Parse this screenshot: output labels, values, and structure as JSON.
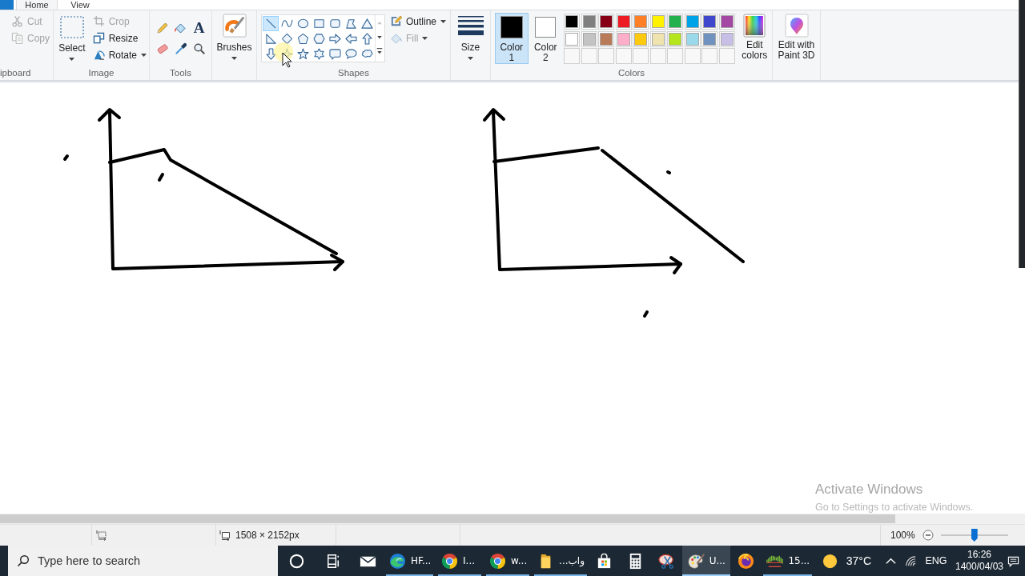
{
  "tabs": [
    {
      "label": "Home",
      "selected": true
    },
    {
      "label": "View",
      "selected": false
    }
  ],
  "ribbon": {
    "clipboard": {
      "label": "ipboard",
      "commands": [
        {
          "kind": "cut",
          "label": "Cut",
          "disabled": true,
          "dropdown": false
        },
        {
          "kind": "copy",
          "label": "Copy",
          "disabled": true,
          "dropdown": false
        }
      ]
    },
    "image": {
      "label": "Image",
      "select": {
        "label": "Select"
      },
      "commands": [
        {
          "kind": "crop",
          "label": "Crop",
          "disabled": true,
          "dropdown": false
        },
        {
          "kind": "resize",
          "label": "Resize",
          "disabled": false,
          "dropdown": false
        },
        {
          "kind": "rotate",
          "label": "Rotate",
          "disabled": false,
          "dropdown": true
        }
      ]
    },
    "tools": {
      "label": "Tools",
      "items": [
        {
          "kind": "pencil"
        },
        {
          "kind": "fill"
        },
        {
          "kind": "text",
          "glyph": "A"
        },
        {
          "kind": "eraser"
        },
        {
          "kind": "color-picker"
        },
        {
          "kind": "magnifier"
        }
      ]
    },
    "brushes": {
      "label": "Brushes"
    },
    "shapes": {
      "label": "Shapes",
      "gallery": [
        {
          "kind": "line",
          "selected": true
        },
        {
          "kind": "curve",
          "selected": false
        },
        {
          "kind": "oval",
          "selected": false
        },
        {
          "kind": "rectangle",
          "selected": false
        },
        {
          "kind": "rounded-rectangle",
          "selected": false
        },
        {
          "kind": "polygon",
          "selected": false
        },
        {
          "kind": "triangle",
          "selected": false
        },
        {
          "kind": "right-triangle",
          "selected": false
        },
        {
          "kind": "diamond",
          "selected": false
        },
        {
          "kind": "pentagon",
          "selected": false
        },
        {
          "kind": "hexagon",
          "selected": false
        },
        {
          "kind": "right-arrow",
          "selected": false
        },
        {
          "kind": "left-arrow",
          "selected": false
        },
        {
          "kind": "up-arrow",
          "selected": false
        },
        {
          "kind": "down-arrow",
          "selected": false
        },
        {
          "kind": "four-point-star",
          "selected": false
        },
        {
          "kind": "five-point-star",
          "selected": false
        },
        {
          "kind": "six-point-star",
          "selected": false
        },
        {
          "kind": "rounded-callout",
          "selected": false
        },
        {
          "kind": "oval-callout",
          "selected": false
        },
        {
          "kind": "cloud-callout",
          "selected": false
        }
      ],
      "commands": [
        {
          "kind": "outline",
          "label": "Outline",
          "disabled": false,
          "dropdown": true
        },
        {
          "kind": "fill",
          "label": "Fill",
          "disabled": true,
          "dropdown": true
        }
      ]
    },
    "size": {
      "label": "Size"
    },
    "colors": {
      "label": "Colors",
      "color_1": {
        "label": "Color 1",
        "color": "#000000",
        "selected": true
      },
      "color_2": {
        "label": "Color 2",
        "color": "#ffffff",
        "selected": false
      },
      "palette": [
        {
          "kind": "color",
          "color": "#000000"
        },
        {
          "kind": "color",
          "color": "#7f7f7f"
        },
        {
          "kind": "color",
          "color": "#880015"
        },
        {
          "kind": "color",
          "color": "#ed1c24"
        },
        {
          "kind": "color",
          "color": "#ff7f27"
        },
        {
          "kind": "color",
          "color": "#fff200"
        },
        {
          "kind": "color",
          "color": "#22b14c"
        },
        {
          "kind": "color",
          "color": "#00a2e8"
        },
        {
          "kind": "color",
          "color": "#3f48cc"
        },
        {
          "kind": "color",
          "color": "#a349a4"
        },
        {
          "kind": "color",
          "color": "#ffffff"
        },
        {
          "kind": "color",
          "color": "#c3c3c3"
        },
        {
          "kind": "color",
          "color": "#b97a57"
        },
        {
          "kind": "color",
          "color": "#ffaec9"
        },
        {
          "kind": "color",
          "color": "#ffc90e"
        },
        {
          "kind": "color",
          "color": "#efe4b0"
        },
        {
          "kind": "color",
          "color": "#b5e61d"
        },
        {
          "kind": "color",
          "color": "#99d9ea"
        },
        {
          "kind": "color",
          "color": "#7092be"
        },
        {
          "kind": "color",
          "color": "#c8bfe7"
        },
        {
          "kind": "empty"
        },
        {
          "kind": "empty"
        },
        {
          "kind": "empty"
        },
        {
          "kind": "empty"
        },
        {
          "kind": "empty"
        },
        {
          "kind": "empty"
        },
        {
          "kind": "empty"
        },
        {
          "kind": "empty"
        },
        {
          "kind": "empty"
        },
        {
          "kind": "empty"
        }
      ],
      "edit_colors": {
        "label": "Edit colors"
      }
    },
    "paint_3d": {
      "label": "Edit with Paint 3D"
    }
  },
  "activation_notice": {
    "title": "Activate Windows",
    "subtitle": "Go to Settings to activate Windows."
  },
  "status_bar": {
    "image_size": "1508 × 2152px",
    "zoom": {
      "reading": "100%",
      "level": 0.5
    }
  },
  "taskbar": {
    "search": {
      "placeholder": "Type here to search"
    },
    "buttons": [
      {
        "kind": "cortana"
      },
      {
        "kind": "task-view"
      }
    ],
    "apps": [
      {
        "kind": "mail",
        "running": false,
        "selected": false
      },
      {
        "kind": "edge",
        "label": "HF...",
        "running": true,
        "selected": false
      },
      {
        "kind": "chrome",
        "label": "I...",
        "running": true,
        "selected": false
      },
      {
        "kind": "chrome",
        "label": "w...",
        "running": true,
        "selected": false
      },
      {
        "kind": "folder",
        "label": "واب...",
        "running": true,
        "selected": false
      },
      {
        "kind": "store",
        "running": false,
        "selected": false
      },
      {
        "kind": "calculator",
        "running": false,
        "selected": false
      },
      {
        "kind": "snipping",
        "running": false,
        "selected": false
      },
      {
        "kind": "paint",
        "label": "U...",
        "running": true,
        "selected": true
      },
      {
        "kind": "firefox",
        "running": false,
        "selected": false
      },
      {
        "kind": "chart",
        "label": "15...",
        "running": true,
        "selected": false
      }
    ],
    "tray": {
      "temperature": "37°C",
      "language": "ENG",
      "time": "16:26",
      "date": "1400/04/03"
    }
  }
}
